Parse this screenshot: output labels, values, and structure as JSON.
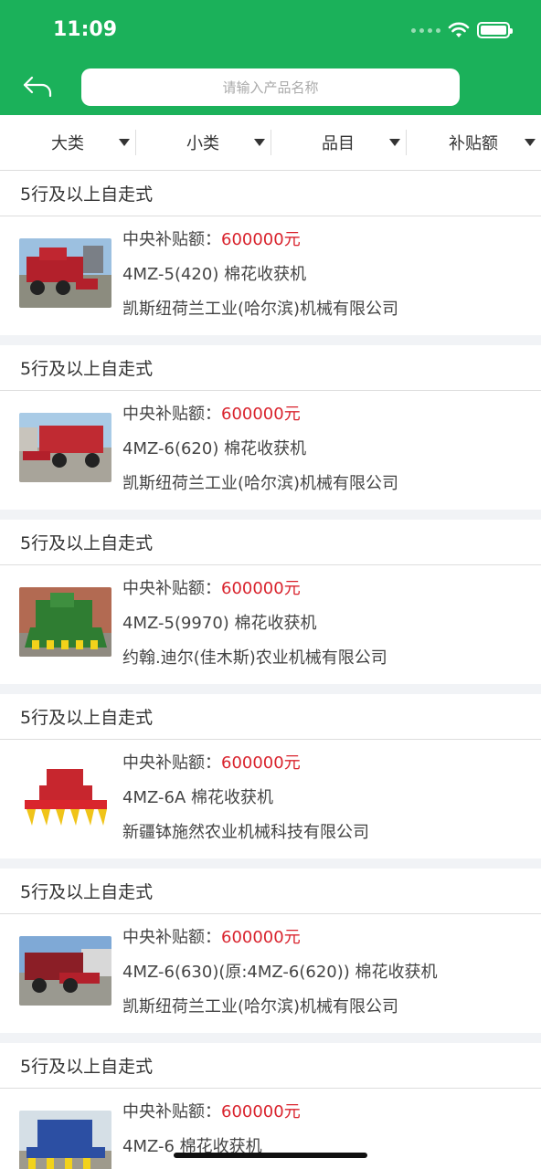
{
  "status": {
    "time": "11:09"
  },
  "search": {
    "placeholder": "请输入产品名称"
  },
  "filters": [
    {
      "label": "大类"
    },
    {
      "label": "小类"
    },
    {
      "label": "品目"
    },
    {
      "label": "补贴额"
    }
  ],
  "items": [
    {
      "category": "5行及以上自走式",
      "subsidy_label": "中央补贴额：",
      "subsidy_value": "600000元",
      "model": "4MZ-5(420) 棉花收获机",
      "company": "凯斯纽荷兰工业(哈尔滨)机械有限公司"
    },
    {
      "category": "5行及以上自走式",
      "subsidy_label": "中央补贴额：",
      "subsidy_value": "600000元",
      "model": "4MZ-6(620) 棉花收获机",
      "company": "凯斯纽荷兰工业(哈尔滨)机械有限公司"
    },
    {
      "category": "5行及以上自走式",
      "subsidy_label": "中央补贴额：",
      "subsidy_value": "600000元",
      "model": "4MZ-5(9970) 棉花收获机",
      "company": "约翰.迪尔(佳木斯)农业机械有限公司"
    },
    {
      "category": "5行及以上自走式",
      "subsidy_label": "中央补贴额：",
      "subsidy_value": "600000元",
      "model": "4MZ-6A 棉花收获机",
      "company": "新疆钵施然农业机械科技有限公司"
    },
    {
      "category": "5行及以上自走式",
      "subsidy_label": "中央补贴额：",
      "subsidy_value": "600000元",
      "model": "4MZ-6(630)(原:4MZ-6(620)) 棉花收获机",
      "company": "凯斯纽荷兰工业(哈尔滨)机械有限公司"
    },
    {
      "category": "5行及以上自走式",
      "subsidy_label": "中央补贴额：",
      "subsidy_value": "600000元",
      "model": "4MZ-6 棉花收获机",
      "company": ""
    }
  ],
  "colors": {
    "header": "#1bb15a",
    "amount": "#d9232d",
    "divider": "#f1f3f6"
  }
}
